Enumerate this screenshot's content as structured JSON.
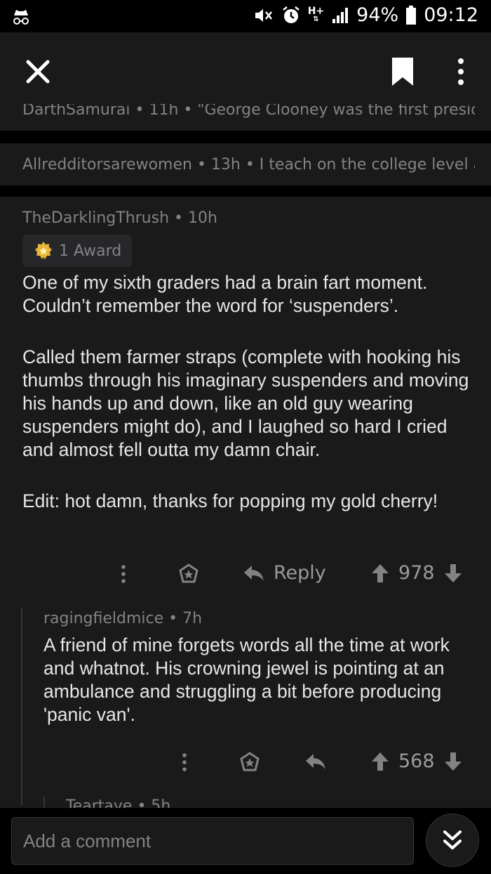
{
  "status_bar": {
    "battery": "94%",
    "time": "09:12",
    "network": "H+"
  },
  "parents": [
    {
      "text": "DarthSamurai • 11h • \"George Clooney was the first presid..."
    },
    {
      "text": "Allredditorsarewomen • 13h • I teach on the college level a..."
    }
  ],
  "comment": {
    "author": "TheDarklingThrush",
    "age": "10h",
    "award": "1 Award",
    "paragraphs": [
      "One of my sixth graders had a brain fart moment. Couldn’t remember the word for ‘suspenders’.",
      "Called them farmer straps (complete with hooking his thumbs through his imaginary suspenders and moving his hands up and down, like an old guy wearing suspenders might do), and I laughed so hard I cried and almost fell outta my damn chair.",
      "Edit:  hot damn, thanks for popping my gold cherry!"
    ],
    "reply_label": "Reply",
    "score": "978"
  },
  "reply": {
    "author": "ragingfieldmice",
    "age": "7h",
    "text": "A friend of mine forgets words all the time at work and whatnot. His crowning jewel is pointing at an ambulance and struggling a bit before producing 'panic van'.",
    "score": "568"
  },
  "sub_reply": {
    "author": "Teartaye",
    "age": "5h"
  },
  "composer": {
    "placeholder": "Add a comment"
  },
  "colors": {
    "background": "#000000",
    "surface": "#1a1a1b",
    "text_primary": "#e6e6e6",
    "text_meta": "#818384",
    "award_bg": "#272729"
  }
}
